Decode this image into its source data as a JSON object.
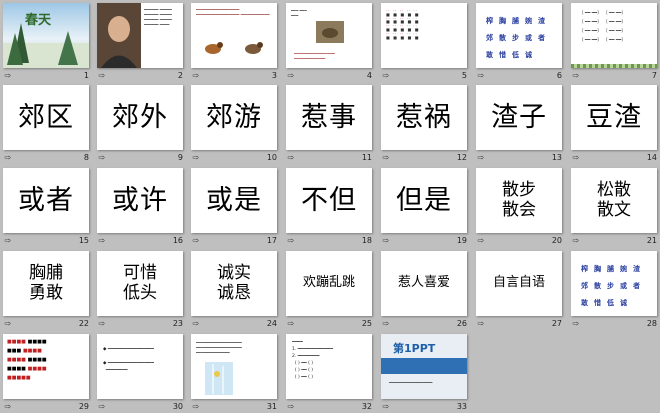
{
  "slides": [
    {
      "n": "1",
      "kind": "title",
      "title": "春天"
    },
    {
      "n": "2",
      "kind": "portrait"
    },
    {
      "n": "3",
      "kind": "birds"
    },
    {
      "n": "4",
      "kind": "text-image"
    },
    {
      "n": "5",
      "kind": "pinyin-grid"
    },
    {
      "n": "6",
      "kind": "blue-words",
      "words": [
        "榨",
        "胸",
        "脯",
        "婉",
        "渣",
        "郊",
        "散",
        "步",
        "或",
        "者",
        "敢",
        "惜",
        "低",
        "诚"
      ]
    },
    {
      "n": "7",
      "kind": "pairs"
    },
    {
      "n": "8",
      "kind": "word",
      "lines": [
        "郊区"
      ]
    },
    {
      "n": "9",
      "kind": "word",
      "lines": [
        "郊外"
      ]
    },
    {
      "n": "10",
      "kind": "word",
      "lines": [
        "郊游"
      ]
    },
    {
      "n": "11",
      "kind": "word",
      "lines": [
        "惹事"
      ]
    },
    {
      "n": "12",
      "kind": "word",
      "lines": [
        "惹祸"
      ]
    },
    {
      "n": "13",
      "kind": "word",
      "lines": [
        "渣子"
      ]
    },
    {
      "n": "14",
      "kind": "word",
      "lines": [
        "豆渣"
      ]
    },
    {
      "n": "15",
      "kind": "word",
      "lines": [
        "或者"
      ]
    },
    {
      "n": "16",
      "kind": "word",
      "lines": [
        "或许"
      ]
    },
    {
      "n": "17",
      "kind": "word",
      "lines": [
        "或是"
      ]
    },
    {
      "n": "18",
      "kind": "word",
      "lines": [
        "不但"
      ]
    },
    {
      "n": "19",
      "kind": "word",
      "lines": [
        "但是"
      ]
    },
    {
      "n": "20",
      "kind": "word2",
      "lines": [
        "散步",
        "散会"
      ]
    },
    {
      "n": "21",
      "kind": "word2",
      "lines": [
        "松散",
        "散文"
      ]
    },
    {
      "n": "22",
      "kind": "word2",
      "lines": [
        "胸脯",
        "勇敢"
      ]
    },
    {
      "n": "23",
      "kind": "word2",
      "lines": [
        "可惜",
        "低头"
      ]
    },
    {
      "n": "24",
      "kind": "word2",
      "lines": [
        "诚实",
        "诚恳"
      ]
    },
    {
      "n": "25",
      "kind": "word4",
      "lines": [
        "欢蹦乱跳"
      ]
    },
    {
      "n": "26",
      "kind": "word4",
      "lines": [
        "惹人喜爱"
      ]
    },
    {
      "n": "27",
      "kind": "word4",
      "lines": [
        "自言自语"
      ]
    },
    {
      "n": "28",
      "kind": "blue-words",
      "words": [
        "榨",
        "胸",
        "脯",
        "婉",
        "渣",
        "郊",
        "散",
        "步",
        "或",
        "者",
        "敢",
        "惜",
        "低",
        "诚"
      ]
    },
    {
      "n": "29",
      "kind": "colored-words"
    },
    {
      "n": "30",
      "kind": "bullets"
    },
    {
      "n": "31",
      "kind": "text-trees"
    },
    {
      "n": "32",
      "kind": "homework"
    },
    {
      "n": "33",
      "kind": "ppt-logo",
      "logo": "第1PPT"
    }
  ]
}
